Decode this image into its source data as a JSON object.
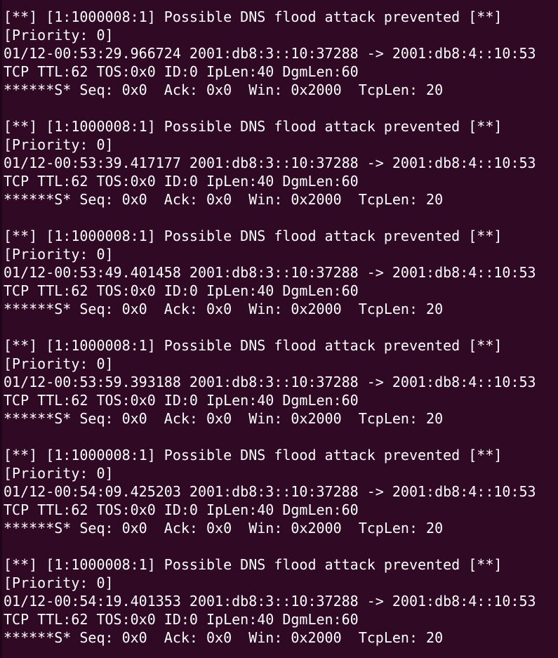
{
  "terminal": {
    "alerts": [
      {
        "header": "[**] [1:1000008:1] Possible DNS flood attack prevented [**]",
        "priority": "[Priority: 0]",
        "flow": "01/12-00:53:29.966724 2001:db8:3::10:37288 -> 2001:db8:4::10:53",
        "ip_info": "TCP TTL:62 TOS:0x0 ID:0 IpLen:40 DgmLen:60",
        "tcp_info": "******S* Seq: 0x0  Ack: 0x0  Win: 0x2000  TcpLen: 20"
      },
      {
        "header": "[**] [1:1000008:1] Possible DNS flood attack prevented [**]",
        "priority": "[Priority: 0]",
        "flow": "01/12-00:53:39.417177 2001:db8:3::10:37288 -> 2001:db8:4::10:53",
        "ip_info": "TCP TTL:62 TOS:0x0 ID:0 IpLen:40 DgmLen:60",
        "tcp_info": "******S* Seq: 0x0  Ack: 0x0  Win: 0x2000  TcpLen: 20"
      },
      {
        "header": "[**] [1:1000008:1] Possible DNS flood attack prevented [**]",
        "priority": "[Priority: 0]",
        "flow": "01/12-00:53:49.401458 2001:db8:3::10:37288 -> 2001:db8:4::10:53",
        "ip_info": "TCP TTL:62 TOS:0x0 ID:0 IpLen:40 DgmLen:60",
        "tcp_info": "******S* Seq: 0x0  Ack: 0x0  Win: 0x2000  TcpLen: 20"
      },
      {
        "header": "[**] [1:1000008:1] Possible DNS flood attack prevented [**]",
        "priority": "[Priority: 0]",
        "flow": "01/12-00:53:59.393188 2001:db8:3::10:37288 -> 2001:db8:4::10:53",
        "ip_info": "TCP TTL:62 TOS:0x0 ID:0 IpLen:40 DgmLen:60",
        "tcp_info": "******S* Seq: 0x0  Ack: 0x0  Win: 0x2000  TcpLen: 20"
      },
      {
        "header": "[**] [1:1000008:1] Possible DNS flood attack prevented [**]",
        "priority": "[Priority: 0]",
        "flow": "01/12-00:54:09.425203 2001:db8:3::10:37288 -> 2001:db8:4::10:53",
        "ip_info": "TCP TTL:62 TOS:0x0 ID:0 IpLen:40 DgmLen:60",
        "tcp_info": "******S* Seq: 0x0  Ack: 0x0  Win: 0x2000  TcpLen: 20"
      },
      {
        "header": "[**] [1:1000008:1] Possible DNS flood attack prevented [**]",
        "priority": "[Priority: 0]",
        "flow": "01/12-00:54:19.401353 2001:db8:3::10:37288 -> 2001:db8:4::10:53",
        "ip_info": "TCP TTL:62 TOS:0x0 ID:0 IpLen:40 DgmLen:60",
        "tcp_info": "******S* Seq: 0x0  Ack: 0x0  Win: 0x2000  TcpLen: 20"
      }
    ]
  },
  "colors": {
    "background": "#300a24",
    "text": "#ffffff"
  }
}
